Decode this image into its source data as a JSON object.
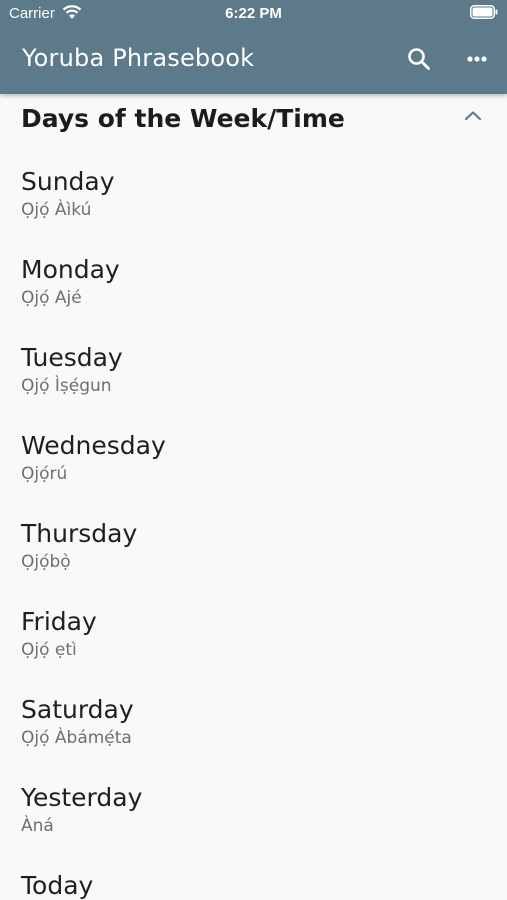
{
  "status_bar": {
    "carrier": "Carrier",
    "time": "6:22 PM"
  },
  "app_bar": {
    "title": "Yoruba Phrasebook",
    "icons": {
      "search": "search-icon",
      "more": "more-horizontal-icon"
    },
    "color": "#5d7a8a"
  },
  "section": {
    "title": "Days of the Week/Time",
    "icon": "chevron-up-icon"
  },
  "phrases": [
    {
      "english": "Sunday",
      "yoruba": "Ọjọ́ Àìkú"
    },
    {
      "english": "Monday",
      "yoruba": "Ọjọ́ Ajé"
    },
    {
      "english": "Tuesday",
      "yoruba": "Ọjọ́ Ìṣẹ́gun"
    },
    {
      "english": "Wednesday",
      "yoruba": "Ọjọ́rú"
    },
    {
      "english": "Thursday",
      "yoruba": "Ọjọ́bọ̀"
    },
    {
      "english": "Friday",
      "yoruba": "Ọjọ́ ẹtì"
    },
    {
      "english": "Saturday",
      "yoruba": "Ọjọ́ Àbámẹ́ta"
    },
    {
      "english": "Yesterday",
      "yoruba": "Àná"
    },
    {
      "english": "Today",
      "yoruba": ""
    }
  ]
}
